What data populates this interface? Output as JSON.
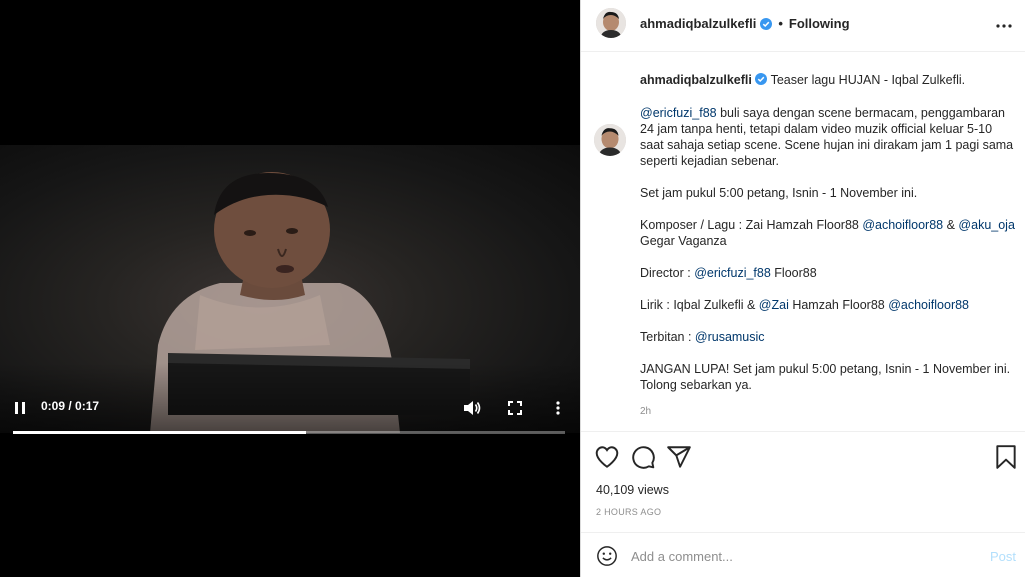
{
  "video": {
    "time_label": "0:09 / 0:17",
    "progress": 0.53
  },
  "header": {
    "username": "ahmadiqbalzulkefli",
    "separator": "•",
    "follow_status": "Following"
  },
  "caption": {
    "username": "ahmadiqbalzulkefli",
    "title": "Teaser lagu HUJAN - Iqbal Zulkefli.",
    "p1_mention": "@ericfuzi_f88",
    "p1_text": " buli saya dengan scene bermacam, penggambaran 24 jam tanpa henti, tetapi dalam video muzik official keluar 5-10 saat sahaja setiap scene. Scene hujan ini dirakam jam 1 pagi sama seperti kejadian sebenar.",
    "p2": "Set jam pukul 5:00 petang, Isnin - 1 November ini.",
    "p3_prefix": "Komposer / Lagu : Zai Hamzah Floor88 ",
    "p3_mention1": "@achoifloor88",
    "p3_amp": " & ",
    "p3_mention2": "@aku_oja",
    "p3_suffix": " Gegar Vaganza",
    "p4_prefix": "Director : ",
    "p4_mention": "@ericfuzi_f88",
    "p4_suffix": " Floor88",
    "p5_prefix": "Lirik : Iqbal Zulkefli & ",
    "p5_mention1": "@Zai",
    "p5_mid": " Hamzah Floor88 ",
    "p5_mention2": "@achoifloor88",
    "p6_prefix": "Terbitan : ",
    "p6_mention": "@rusamusic",
    "p7": "JANGAN LUPA! Set jam pukul 5:00 petang, Isnin - 1 November ini. Tolong sebarkan ya.",
    "time_ago": "2h"
  },
  "stats": {
    "views": "40,109 views",
    "date": "2 HOURS AGO"
  },
  "comment": {
    "placeholder": "Add a comment...",
    "post_label": "Post"
  },
  "icons": {
    "verified": "verified-badge-icon",
    "like": "heart-icon",
    "comment": "comment-bubble-icon",
    "share": "paper-plane-icon",
    "save": "bookmark-icon",
    "emoji": "smiley-icon"
  },
  "colors": {
    "verified": "#3897f0",
    "mention": "#00376b",
    "post_disabled": "#b2dffc"
  }
}
